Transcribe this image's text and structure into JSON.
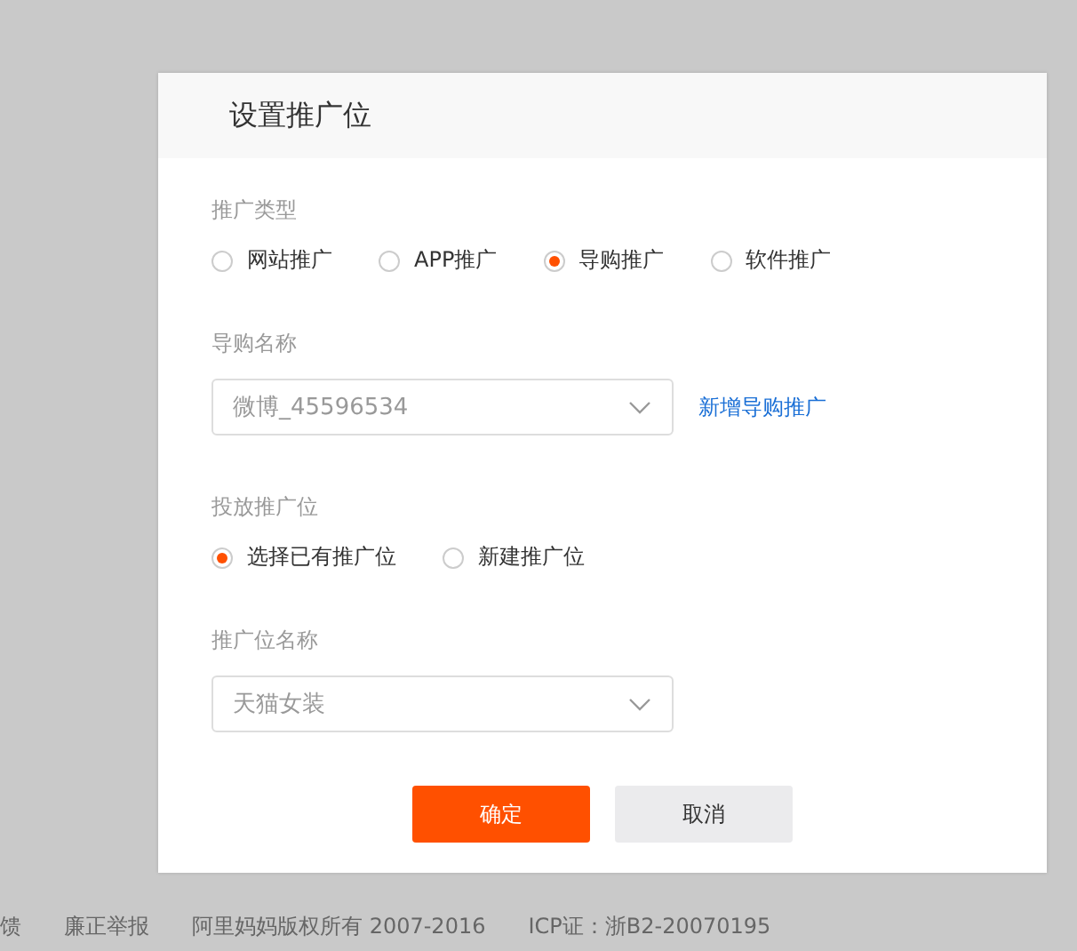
{
  "dialog": {
    "title": "设置推广位",
    "sections": [
      {
        "kind": "radio",
        "label": "推广类型",
        "options": [
          {
            "label": "网站推广",
            "selected": false
          },
          {
            "label": "APP推广",
            "selected": false
          },
          {
            "label": "导购推广",
            "selected": true
          },
          {
            "label": "软件推广",
            "selected": false
          }
        ]
      },
      {
        "kind": "select",
        "label": "导购名称",
        "value": "微博_45596534",
        "link": "新增导购推广"
      },
      {
        "kind": "radio",
        "label": "投放推广位",
        "options": [
          {
            "label": "选择已有推广位",
            "selected": true
          },
          {
            "label": "新建推广位",
            "selected": false
          }
        ]
      },
      {
        "kind": "select",
        "label": "推广位名称",
        "value": "天猫女装"
      }
    ],
    "buttons": [
      {
        "label": "确定",
        "kind": "primary"
      },
      {
        "label": "取消",
        "kind": "secondary"
      }
    ]
  },
  "footer": [
    "馈",
    "廉正举报",
    "阿里妈妈版权所有 2007-2016",
    "ICP证：浙B2-20070195"
  ]
}
